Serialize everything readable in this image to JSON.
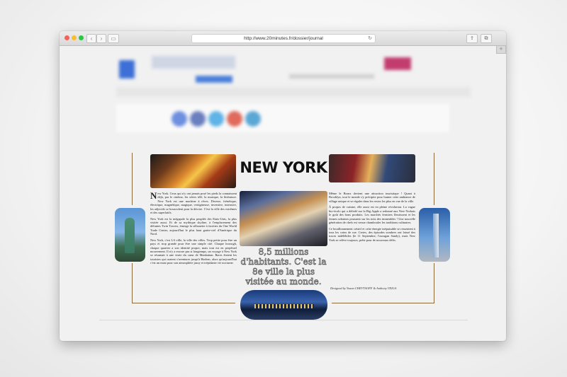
{
  "browser": {
    "url": "http://www.20minutes.fr/dossier/journal",
    "back_glyph": "‹",
    "forward_glyph": "›",
    "sidebar_glyph": "▭",
    "reload_glyph": "↻",
    "share_glyph": "⇪",
    "tabs_glyph": "⧉",
    "newtab_glyph": "+"
  },
  "colors": {
    "accent_rule": "#8b6b3c",
    "site_blue": "#3d6fd6",
    "site_pink": "#c23d6e"
  },
  "journal": {
    "title": "NEW YORK",
    "left": {
      "dropcap": "N",
      "p1": "ew York. Ceux qui n'y ont jamais posé les pieds la connaissent déjà, par le cinéma, les séries télé, la musique, la littérature. New York est une machine à rêves. Diverse, frénétique, électrique, magnétique, magique, vertigineuse, inventive, intensive, les adjectifs se bousculent pour la décrire. C'est la ville des extrêmes et des superlatifs.",
      "p2": "New York est la mégapole la plus peuplée des Etats-Unis, la plus visitée aussi. Et de sa mythique skyline, à l'emplacement des défuntes Twin Towers, émerge la silhouette à facettes du One World Trade Center, aujourd'hui le plus haut gratte-ciel d'Amérique du Nord.",
      "p3": "New York, c'est LA ville, la ville des villes. Trop petite pour être un pays et trop grande pour être une simple cité. Chaque borough, chaque quartier a son identité propre, mais tout est en perpétuel mouvement. Il n'y a encore pas si longtemps, un voyage à New York se résumait à une visite du cœur de Manhattan. Rares étaient les touristes qui osaient s'aventurer jusqu'à Harlem, alors qu'aujourd'hui c'est un must pour son atmosphère jazzy et trépidante vie nocturne."
    },
    "right": {
      "p1": "Même le Bronx devient une attraction touristique ! Quant à Brooklyn, tout le monde s'y précipite pour humer cette ambiance de village unique et se régaler dans les restos les plus en vue de la ville.",
      "p2": "À propos de cuisine, elle aussi est en pleine révolution. La vague bio-écolo qui a déferlé sur la Big Apple a redonné aux New-Yorkais le goût des bons produits. Les marchés fermiers fleurissent et les fermes urbaines poussent sur les toits des immeubles ! Une nouvelle génération de chefs est venue chambouler les traditions culinaires.",
      "p3": "Ce bouillonnement créatif et cette énergie inépuisable se ressentent à tous les coins de rue. Certes, des épisodes sombres ont laissé des traces indélébiles (le 11 Septembre, l'ouragan Sandy), mais New York se relève toujours, prête pour de nouveaux défis."
    },
    "quote": "8,5 millions d'habitants. C'est la 8e ville la plus visitée au monde.",
    "credit": "Designed by Yoann CHEVTSOFF & Anthony VEIGA"
  }
}
